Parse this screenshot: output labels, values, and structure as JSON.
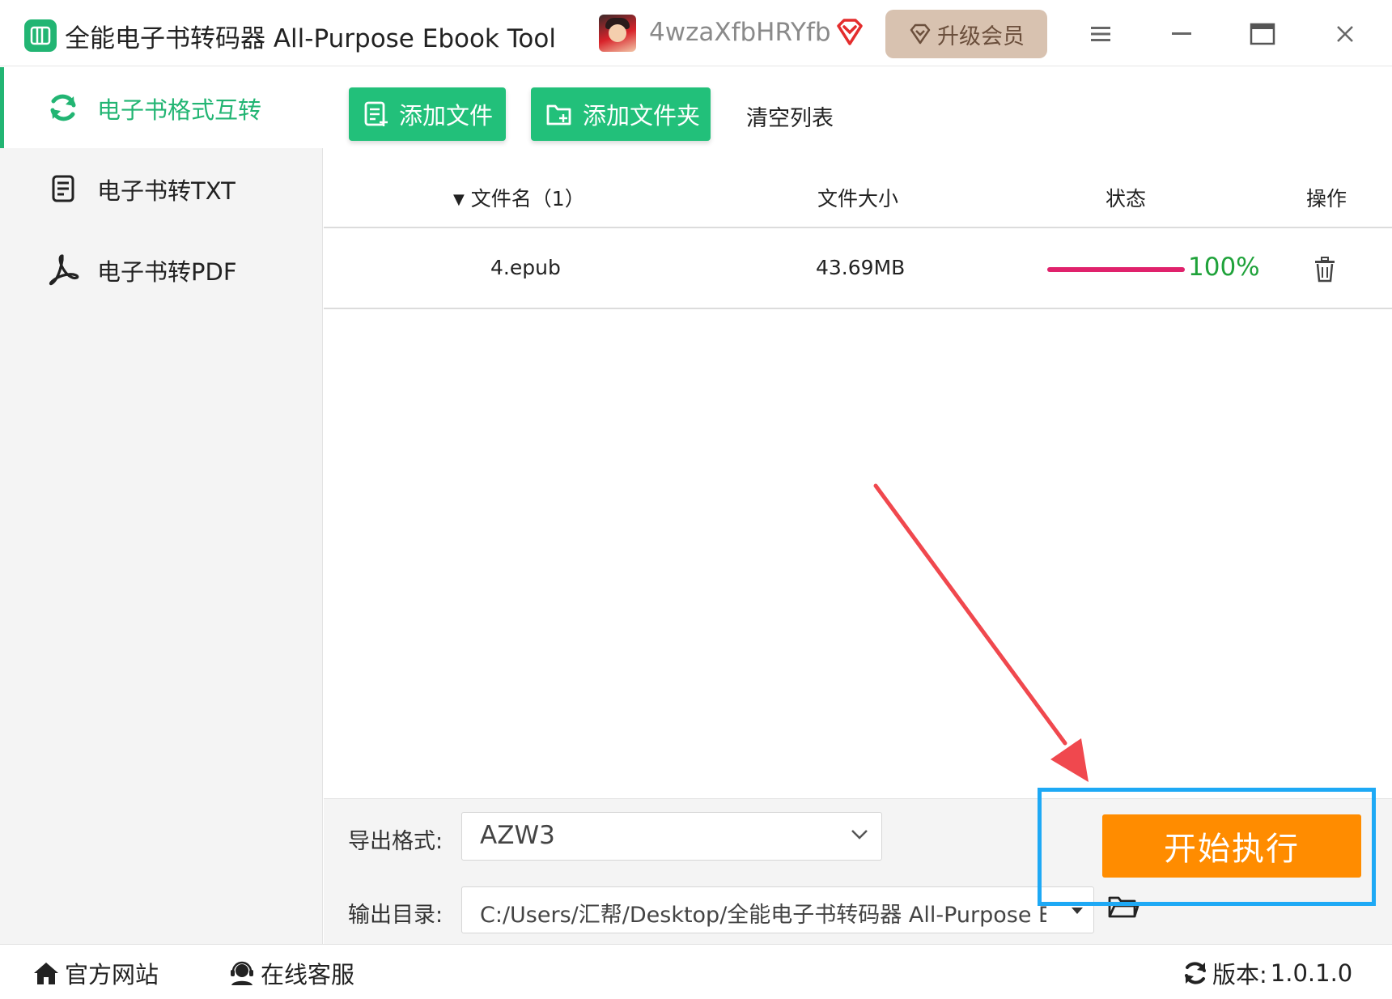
{
  "window": {
    "title": "全能电子书转码器 All-Purpose Ebook Tool",
    "username": "4wzaXfbHRYfb",
    "upgrade_label": "升级会员"
  },
  "sidebar": {
    "items": [
      {
        "label": "电子书格式互转",
        "icon": "sync-icon",
        "active": true
      },
      {
        "label": "电子书转TXT",
        "icon": "document-icon",
        "active": false
      },
      {
        "label": "电子书转PDF",
        "icon": "pdf-icon",
        "active": false
      }
    ]
  },
  "toolbar": {
    "add_file_label": "添加文件",
    "add_folder_label": "添加文件夹",
    "clear_label": "清空列表"
  },
  "table": {
    "headers": {
      "filename": "文件名（1）",
      "size": "文件大小",
      "status": "状态",
      "action": "操作"
    },
    "rows": [
      {
        "filename": "4.epub",
        "size": "43.69MB",
        "progress": 1.0,
        "progress_text": "100%"
      }
    ]
  },
  "output": {
    "format_label": "导出格式:",
    "format_value": "AZW3",
    "dir_label": "输出目录:",
    "dir_value": "C:/Users/汇帮/Desktop/全能电子书转码器 All-Purpose Ebook Tool"
  },
  "start_label": "开始执行",
  "statusbar": {
    "website_label": "官方网站",
    "support_label": "在线客服",
    "version_label": "版本:",
    "version_value": "1.0.1.0"
  },
  "colors": {
    "accent_green": "#22b573",
    "start_orange": "#ff8c00",
    "progress_pink": "#e0226c",
    "percent_green": "#1fa23a",
    "highlight_blue": "#1ea9f5",
    "annotation_red": "#f0484e"
  }
}
